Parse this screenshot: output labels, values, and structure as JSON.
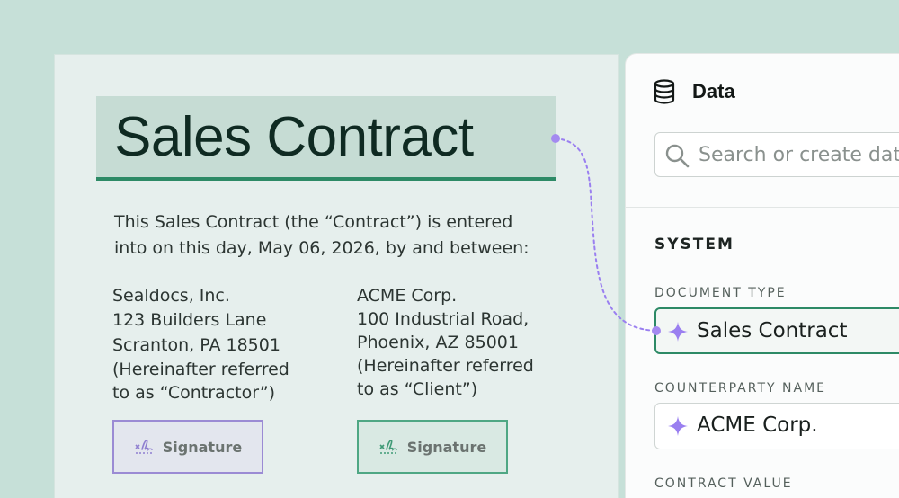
{
  "document": {
    "title": "Sales Contract",
    "intro_line1": "This Sales Contract (the “Contract”) is entered",
    "intro_line2": "into on this day, May 06, 2026, by and between:",
    "party_left": {
      "line1": "Sealdocs, Inc.",
      "line2": "123 Builders Lane",
      "line3": "Scranton, PA 18501",
      "line4": "(Hereinafter referred",
      "line5": "to as “Contractor”)"
    },
    "party_right": {
      "line1": "ACME Corp.",
      "line2": "100 Industrial Road,",
      "line3": "Phoenix, AZ 85001",
      "line4": "(Hereinafter referred",
      "line5": "to as “Client”)"
    },
    "signature_left_label": "Signature",
    "signature_right_label": "Signature"
  },
  "panel": {
    "title": "Data",
    "search_placeholder": "Search or create data",
    "section_title": "SYSTEM",
    "fields": [
      {
        "label": "DOCUMENT TYPE",
        "value": "Sales Contract"
      },
      {
        "label": "COUNTERPARTY NAME",
        "value": "ACME Corp."
      },
      {
        "label": "CONTRACT VALUE",
        "value": ""
      }
    ]
  },
  "colors": {
    "background": "#c6e0d8",
    "accent_green": "#2d8a66",
    "accent_purple": "#9b8bd4",
    "sparkle": "#9a7ff0"
  },
  "icons": {
    "database": "database-icon",
    "search": "search-icon",
    "sparkle": "sparkle-icon",
    "signature": "signature-icon"
  }
}
